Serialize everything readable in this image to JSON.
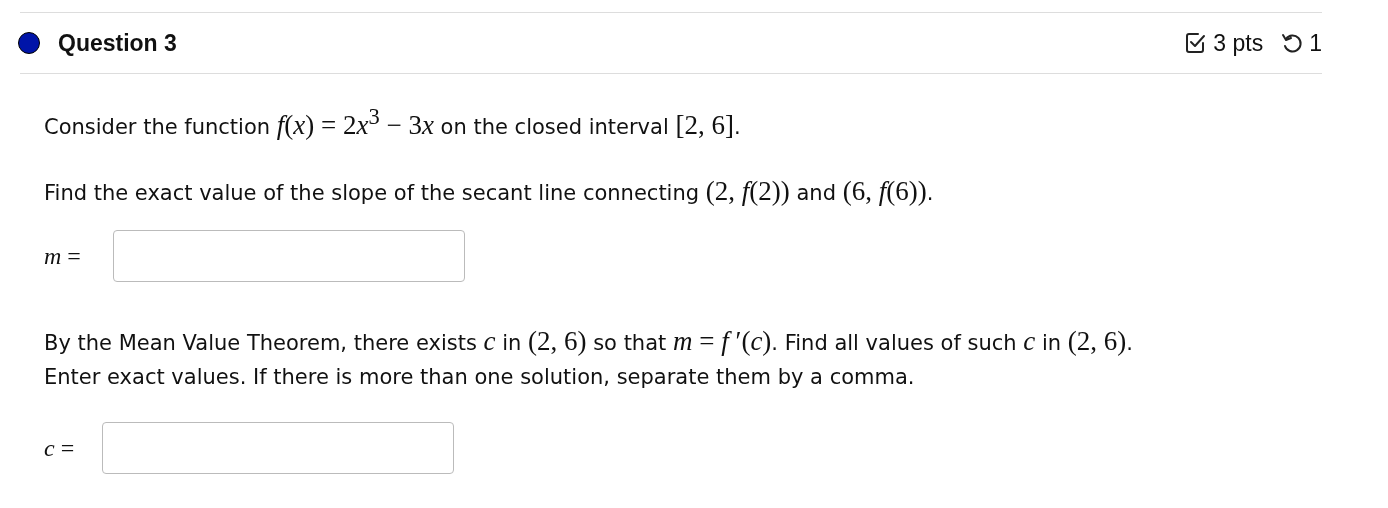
{
  "header": {
    "title": "Question 3",
    "points": "3 pts",
    "attempts": "1"
  },
  "paragraphs": [
    [
      {
        "kind": "text",
        "s": "Consider the function "
      },
      {
        "kind": "math",
        "s": "*f*(*x*) = 2"
      },
      {
        "kind": "var",
        "s": "x"
      },
      {
        "kind": "math",
        "s": "$^{3}$ − 3"
      },
      {
        "kind": "var",
        "s": "x"
      },
      {
        "kind": "text",
        "s": " on the closed interval "
      },
      {
        "kind": "math",
        "s": "[2, 6]"
      },
      {
        "kind": "text",
        "s": "."
      }
    ],
    [
      {
        "kind": "text",
        "s": "Find the exact value of the slope of the secant line connecting "
      },
      {
        "kind": "math",
        "s": "(2, *f*(2))"
      },
      {
        "kind": "text",
        "s": " and "
      },
      {
        "kind": "math",
        "s": "(6, *f*(6))"
      },
      {
        "kind": "text",
        "s": "."
      }
    ]
  ],
  "answer_1": {
    "label": "*m* ="
  },
  "paragraphs_2": [
    [
      {
        "kind": "text",
        "s": "By the Mean Value Theorem, there exists "
      },
      {
        "kind": "math",
        "s": "*c*"
      },
      {
        "kind": "text",
        "s": " in "
      },
      {
        "kind": "math",
        "s": "(2, 6)"
      },
      {
        "kind": "text",
        "s": " so that "
      },
      {
        "kind": "math",
        "s": "*m* = *f* ′(*c*)"
      },
      {
        "kind": "text",
        "s": ". Find all values of such "
      },
      {
        "kind": "math",
        "s": "*c*"
      },
      {
        "kind": "text",
        "s": " in "
      },
      {
        "kind": "math",
        "s": "(2, 6)"
      },
      {
        "kind": "text",
        "s": "."
      },
      {
        "kind": "break"
      },
      {
        "kind": "text",
        "s": "Enter exact values. If there is more than one solution, separate them by a comma."
      }
    ]
  ],
  "answer_2": {
    "label": "*c* ="
  }
}
